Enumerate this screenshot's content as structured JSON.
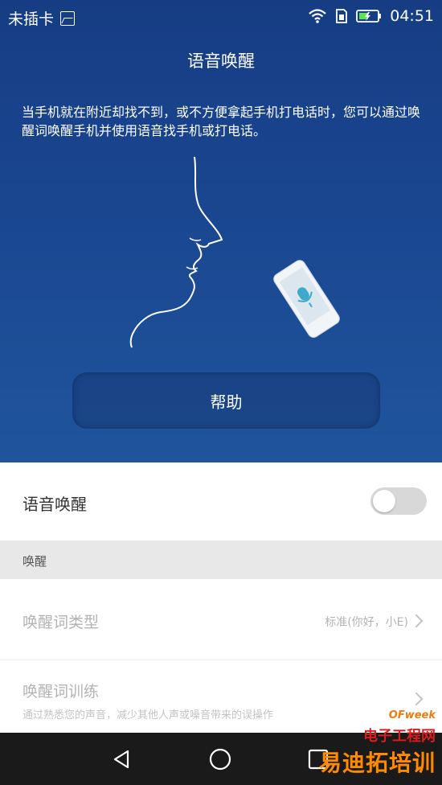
{
  "status_bar": {
    "carrier": "未插卡",
    "time": "04:51"
  },
  "header": {
    "title": "语音唤醒",
    "description": "当手机就在附近却找不到，或不方便拿起手机打电话时，您可以通过唤醒词唤醒手机并使用语音找手机或打电话。",
    "help_button": "帮助"
  },
  "settings": {
    "toggle_label": "语音唤醒",
    "toggle_on": false,
    "section_header": "唤醒",
    "items": [
      {
        "label": "唤醒词类型",
        "value": "标准(你好，小E)"
      },
      {
        "label": "唤醒词训练",
        "subtitle": "通过熟悉您的声音，减少其他人声或噪音带来的误操作"
      }
    ]
  },
  "watermark": {
    "brand": "OFweek",
    "line1": "电子工程网",
    "line2": "易迪拓培训"
  },
  "colors": {
    "hero": "#1a4690",
    "toggle_off": "#d8d8d8",
    "nav_bar": "#1a1a1a"
  }
}
